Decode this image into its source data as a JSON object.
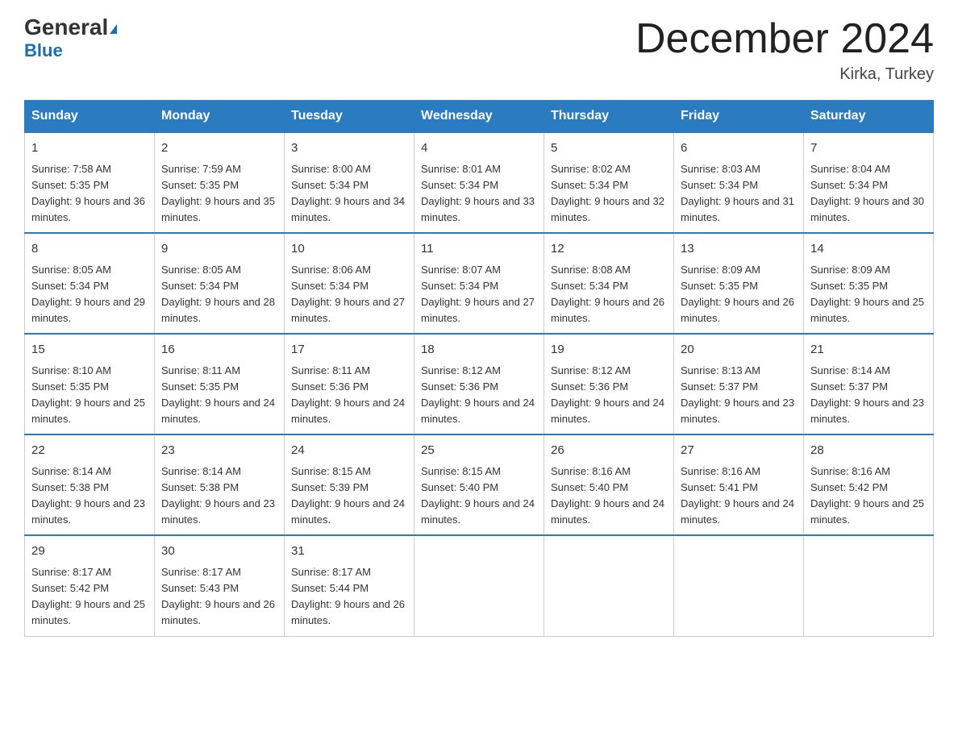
{
  "header": {
    "logo_main": "General",
    "logo_sub": "Blue",
    "month_title": "December 2024",
    "location": "Kirka, Turkey"
  },
  "weekdays": [
    "Sunday",
    "Monday",
    "Tuesday",
    "Wednesday",
    "Thursday",
    "Friday",
    "Saturday"
  ],
  "weeks": [
    [
      {
        "day": "1",
        "sunrise": "7:58 AM",
        "sunset": "5:35 PM",
        "daylight": "9 hours and 36 minutes."
      },
      {
        "day": "2",
        "sunrise": "7:59 AM",
        "sunset": "5:35 PM",
        "daylight": "9 hours and 35 minutes."
      },
      {
        "day": "3",
        "sunrise": "8:00 AM",
        "sunset": "5:34 PM",
        "daylight": "9 hours and 34 minutes."
      },
      {
        "day": "4",
        "sunrise": "8:01 AM",
        "sunset": "5:34 PM",
        "daylight": "9 hours and 33 minutes."
      },
      {
        "day": "5",
        "sunrise": "8:02 AM",
        "sunset": "5:34 PM",
        "daylight": "9 hours and 32 minutes."
      },
      {
        "day": "6",
        "sunrise": "8:03 AM",
        "sunset": "5:34 PM",
        "daylight": "9 hours and 31 minutes."
      },
      {
        "day": "7",
        "sunrise": "8:04 AM",
        "sunset": "5:34 PM",
        "daylight": "9 hours and 30 minutes."
      }
    ],
    [
      {
        "day": "8",
        "sunrise": "8:05 AM",
        "sunset": "5:34 PM",
        "daylight": "9 hours and 29 minutes."
      },
      {
        "day": "9",
        "sunrise": "8:05 AM",
        "sunset": "5:34 PM",
        "daylight": "9 hours and 28 minutes."
      },
      {
        "day": "10",
        "sunrise": "8:06 AM",
        "sunset": "5:34 PM",
        "daylight": "9 hours and 27 minutes."
      },
      {
        "day": "11",
        "sunrise": "8:07 AM",
        "sunset": "5:34 PM",
        "daylight": "9 hours and 27 minutes."
      },
      {
        "day": "12",
        "sunrise": "8:08 AM",
        "sunset": "5:34 PM",
        "daylight": "9 hours and 26 minutes."
      },
      {
        "day": "13",
        "sunrise": "8:09 AM",
        "sunset": "5:35 PM",
        "daylight": "9 hours and 26 minutes."
      },
      {
        "day": "14",
        "sunrise": "8:09 AM",
        "sunset": "5:35 PM",
        "daylight": "9 hours and 25 minutes."
      }
    ],
    [
      {
        "day": "15",
        "sunrise": "8:10 AM",
        "sunset": "5:35 PM",
        "daylight": "9 hours and 25 minutes."
      },
      {
        "day": "16",
        "sunrise": "8:11 AM",
        "sunset": "5:35 PM",
        "daylight": "9 hours and 24 minutes."
      },
      {
        "day": "17",
        "sunrise": "8:11 AM",
        "sunset": "5:36 PM",
        "daylight": "9 hours and 24 minutes."
      },
      {
        "day": "18",
        "sunrise": "8:12 AM",
        "sunset": "5:36 PM",
        "daylight": "9 hours and 24 minutes."
      },
      {
        "day": "19",
        "sunrise": "8:12 AM",
        "sunset": "5:36 PM",
        "daylight": "9 hours and 24 minutes."
      },
      {
        "day": "20",
        "sunrise": "8:13 AM",
        "sunset": "5:37 PM",
        "daylight": "9 hours and 23 minutes."
      },
      {
        "day": "21",
        "sunrise": "8:14 AM",
        "sunset": "5:37 PM",
        "daylight": "9 hours and 23 minutes."
      }
    ],
    [
      {
        "day": "22",
        "sunrise": "8:14 AM",
        "sunset": "5:38 PM",
        "daylight": "9 hours and 23 minutes."
      },
      {
        "day": "23",
        "sunrise": "8:14 AM",
        "sunset": "5:38 PM",
        "daylight": "9 hours and 23 minutes."
      },
      {
        "day": "24",
        "sunrise": "8:15 AM",
        "sunset": "5:39 PM",
        "daylight": "9 hours and 24 minutes."
      },
      {
        "day": "25",
        "sunrise": "8:15 AM",
        "sunset": "5:40 PM",
        "daylight": "9 hours and 24 minutes."
      },
      {
        "day": "26",
        "sunrise": "8:16 AM",
        "sunset": "5:40 PM",
        "daylight": "9 hours and 24 minutes."
      },
      {
        "day": "27",
        "sunrise": "8:16 AM",
        "sunset": "5:41 PM",
        "daylight": "9 hours and 24 minutes."
      },
      {
        "day": "28",
        "sunrise": "8:16 AM",
        "sunset": "5:42 PM",
        "daylight": "9 hours and 25 minutes."
      }
    ],
    [
      {
        "day": "29",
        "sunrise": "8:17 AM",
        "sunset": "5:42 PM",
        "daylight": "9 hours and 25 minutes."
      },
      {
        "day": "30",
        "sunrise": "8:17 AM",
        "sunset": "5:43 PM",
        "daylight": "9 hours and 26 minutes."
      },
      {
        "day": "31",
        "sunrise": "8:17 AM",
        "sunset": "5:44 PM",
        "daylight": "9 hours and 26 minutes."
      },
      null,
      null,
      null,
      null
    ]
  ]
}
